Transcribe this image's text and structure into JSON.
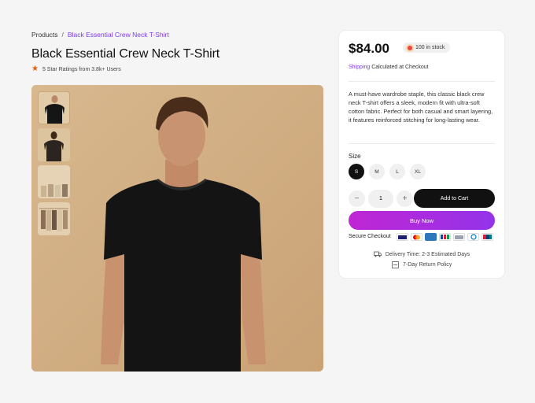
{
  "breadcrumb": {
    "root": "Products",
    "separator": "/",
    "current": "Black Essential Crew Neck T-Shirt"
  },
  "product": {
    "title": "Black Essential Crew Neck T-Shirt",
    "ratings_text": "5 Star Ratings from 3.8k+ Users",
    "rating_icon": "star-icon",
    "image": "black-t-shirt-model-photo",
    "thumbnails": [
      "t-shirt-model-front",
      "t-shirt-model-back",
      "folded-shirts-rack",
      "shirts-on-hangers"
    ]
  },
  "panel": {
    "price": "$84.00",
    "stock": "100 in stock",
    "shipping_link": "Shipping",
    "shipping_text": " Calculated at Checkout",
    "description": "A must-have wardrobe staple, this classic black crew neck T-shirt offers a sleek, modern fit with ultra-soft cotton fabric. Perfect for both casual and smart layering, it features reinforced stitching for long-lasting wear.",
    "size_label": "Size",
    "sizes": [
      "S",
      "M",
      "L",
      "XL"
    ],
    "selected_size": "S",
    "quantity": "1",
    "minus": "−",
    "plus": "+",
    "add_to_cart": "Add to Cart",
    "buy_now": "Buy Now",
    "secure_checkout": "Secure Checkout",
    "payment_icons": [
      "visa-icon",
      "mastercard-icon",
      "amex-icon",
      "jcb-icon",
      "generic-card-icon",
      "diners-icon",
      "unionpay-icon"
    ],
    "delivery": "Delivery Time: 2-3 Estimated Days",
    "returns": "7-Day Return Policy"
  },
  "colors": {
    "accent": "#7c3aed",
    "buy_gradient_start": "#c026d3",
    "buy_gradient_end": "#9333ea",
    "stock_dot": "#ef4444",
    "star": "#ea580c"
  }
}
